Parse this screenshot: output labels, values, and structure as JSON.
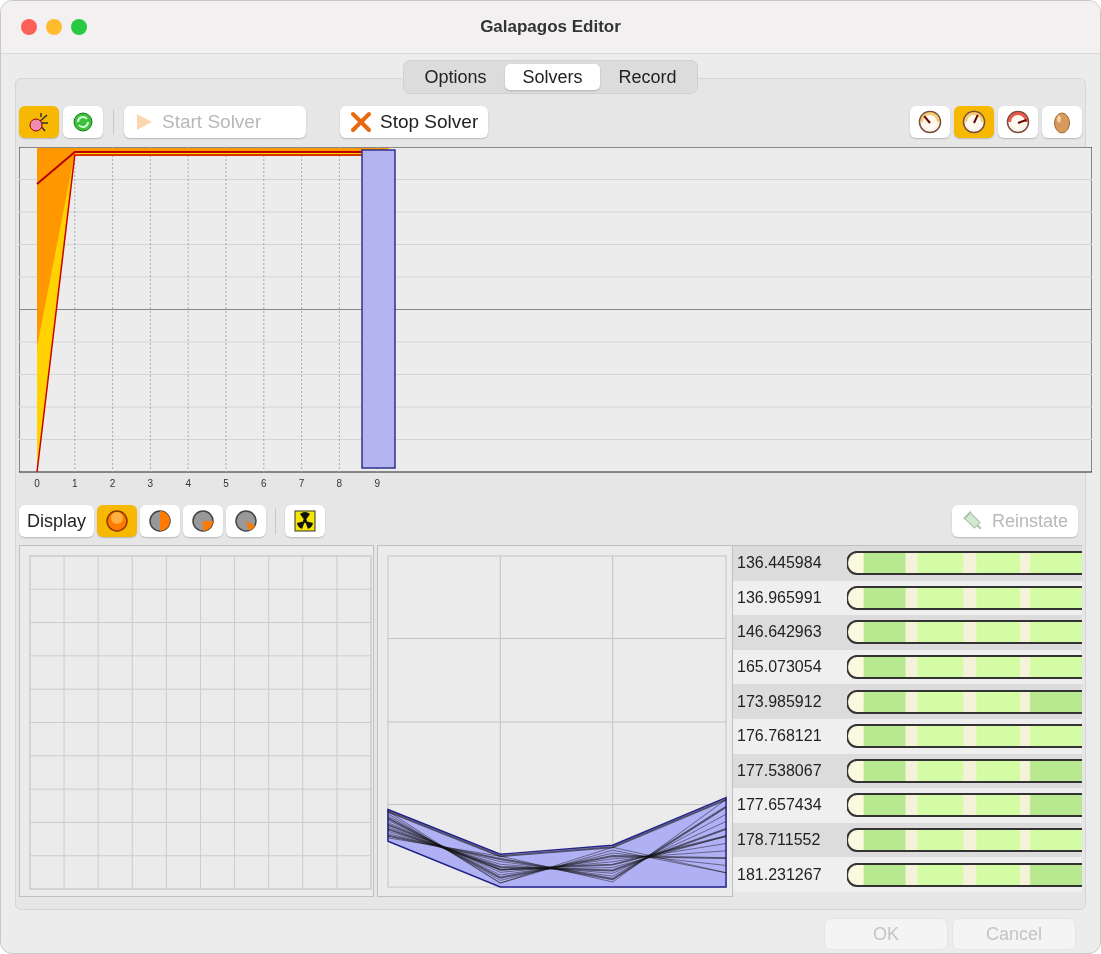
{
  "window": {
    "title": "Galapagos Editor"
  },
  "tabs": [
    {
      "label": "Options",
      "selected": false
    },
    {
      "label": "Solvers",
      "selected": true
    },
    {
      "label": "Record",
      "selected": false
    }
  ],
  "solver_toolbar": {
    "left_tools": [
      {
        "kind": "bug",
        "selected": true
      },
      {
        "kind": "recycle",
        "selected": false
      }
    ],
    "start_button": {
      "label": "Start Solver",
      "disabled": true
    },
    "stop_button": {
      "label": "Stop Solver",
      "disabled": false
    },
    "speed_tools": [
      {
        "kind": "slow",
        "selected": false
      },
      {
        "kind": "medium",
        "selected": true
      },
      {
        "kind": "fast",
        "selected": false
      },
      {
        "kind": "egg",
        "selected": false
      }
    ]
  },
  "fitness_chart": {
    "x_ticks": [
      "0",
      "1",
      "2",
      "3",
      "4",
      "5",
      "6",
      "7",
      "8",
      "9"
    ]
  },
  "display_toolbar": {
    "label": "Display",
    "modes": [
      {
        "kind": "full",
        "selected": true
      },
      {
        "kind": "half",
        "selected": false
      },
      {
        "kind": "quarter",
        "selected": false
      },
      {
        "kind": "eighth",
        "selected": false
      }
    ],
    "reinstate_button": {
      "label": "Reinstate",
      "disabled": true
    }
  },
  "genomes": [
    {
      "fitness": "136.445984",
      "highlight_last": false
    },
    {
      "fitness": "136.965991",
      "highlight_last": false
    },
    {
      "fitness": "146.642963",
      "highlight_last": false
    },
    {
      "fitness": "165.073054",
      "highlight_last": false
    },
    {
      "fitness": "173.985912",
      "highlight_last": true
    },
    {
      "fitness": "176.768121",
      "highlight_last": false
    },
    {
      "fitness": "177.538067",
      "highlight_last": true
    },
    {
      "fitness": "177.657434",
      "highlight_last": true
    },
    {
      "fitness": "178.711552",
      "highlight_last": false
    },
    {
      "fitness": "181.231267",
      "highlight_last": true
    }
  ],
  "buttons": [
    {
      "label": "OK",
      "disabled": true
    },
    {
      "label": "Cancel",
      "disabled": true
    }
  ]
}
